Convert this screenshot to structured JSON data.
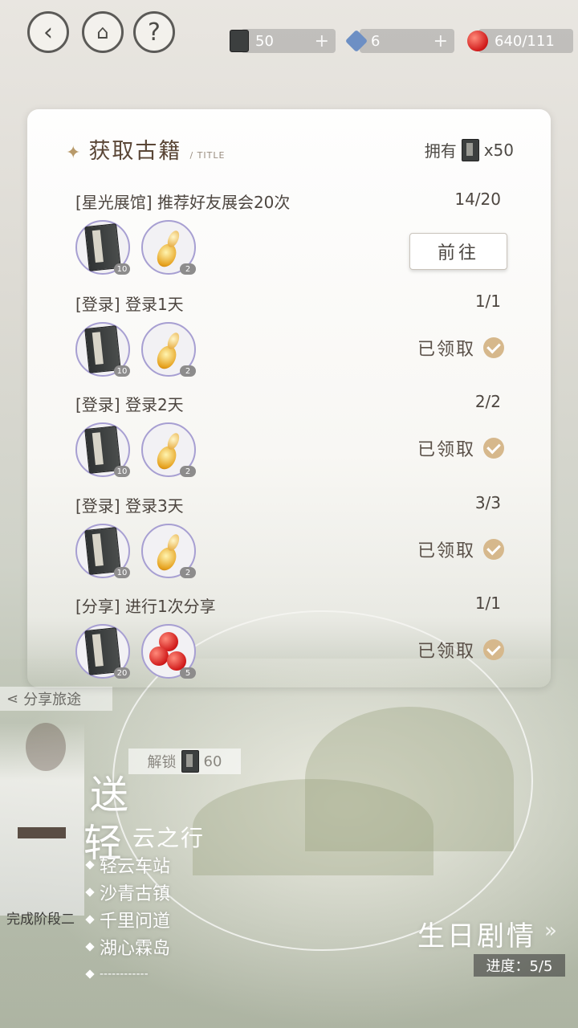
{
  "topbar": {
    "help": "?",
    "resources": [
      {
        "name": "book",
        "value": "50"
      },
      {
        "name": "crystal",
        "value": "6"
      },
      {
        "name": "apple",
        "value": "640/111"
      }
    ]
  },
  "panel": {
    "title": "获取古籍",
    "subtitle": "/ TITLE",
    "owned_label": "拥有",
    "owned_count": "x50",
    "tasks": [
      {
        "name": "[星光展馆] 推荐好友展会20次",
        "count": "14/20",
        "rewards": [
          {
            "icon": "book-icon",
            "qty": "10"
          },
          {
            "icon": "gourd-icon",
            "qty": "2"
          }
        ],
        "action": "前往"
      },
      {
        "name": "[登录] 登录1天",
        "count": "1/1",
        "rewards": [
          {
            "icon": "book-icon",
            "qty": "10"
          },
          {
            "icon": "gourd-icon",
            "qty": "2"
          }
        ],
        "status": "已领取"
      },
      {
        "name": "[登录] 登录2天",
        "count": "2/2",
        "rewards": [
          {
            "icon": "book-icon",
            "qty": "10"
          },
          {
            "icon": "gourd-icon",
            "qty": "2"
          }
        ],
        "status": "已领取"
      },
      {
        "name": "[登录] 登录3天",
        "count": "3/3",
        "rewards": [
          {
            "icon": "book-icon",
            "qty": "10"
          },
          {
            "icon": "gourd-icon",
            "qty": "2"
          }
        ],
        "status": "已领取"
      },
      {
        "name": "[分享] 进行1次分享",
        "count": "1/1",
        "rewards": [
          {
            "icon": "book-icon",
            "qty": "20"
          },
          {
            "icon": "apple-icon",
            "qty": "5"
          }
        ],
        "status": "已领取"
      }
    ]
  },
  "background": {
    "share_label": "分享旅途",
    "unlock_label": "解锁",
    "unlock_cost": "60",
    "big_char_1": "送",
    "big_char_2": "轻",
    "route_title": "云之行",
    "stations": [
      "轻云车站",
      "沙青古镇",
      "千里问道",
      "湖心霖岛",
      "------------"
    ],
    "stage_done": "完成阶段二",
    "birthday": "生日剧情",
    "birthday_arrow": "»",
    "progress": "进度：5/5"
  }
}
